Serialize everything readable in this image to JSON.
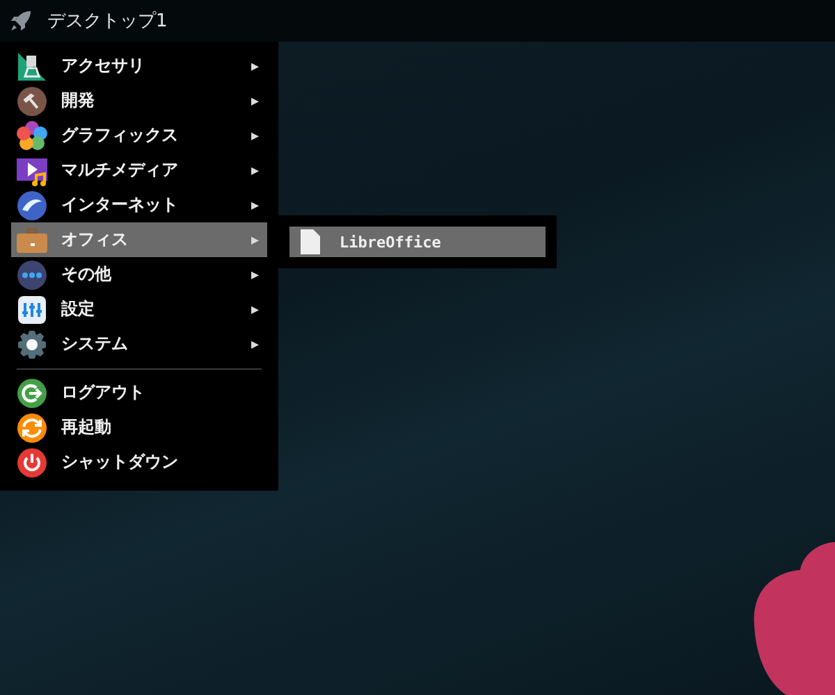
{
  "panel": {
    "title": "デスクトップ1"
  },
  "menu": {
    "categories": [
      {
        "label": "アクセサリ",
        "arrow": "▸",
        "selected": false
      },
      {
        "label": "開発",
        "arrow": "▸",
        "selected": false
      },
      {
        "label": "グラフィックス",
        "arrow": "▸",
        "selected": false
      },
      {
        "label": "マルチメディア",
        "arrow": "▸",
        "selected": false
      },
      {
        "label": "インターネット",
        "arrow": "▸",
        "selected": false
      },
      {
        "label": "オフィス",
        "arrow": "▸",
        "selected": true
      },
      {
        "label": "その他",
        "arrow": "▸",
        "selected": false
      },
      {
        "label": "設定",
        "arrow": "▸",
        "selected": false
      },
      {
        "label": "システム",
        "arrow": "▸",
        "selected": false
      }
    ],
    "actions": [
      {
        "label": "ログアウト"
      },
      {
        "label": "再起動"
      },
      {
        "label": "シャットダウン"
      }
    ]
  },
  "submenu": {
    "items": [
      {
        "label": "LibreOffice",
        "selected": true
      }
    ]
  }
}
